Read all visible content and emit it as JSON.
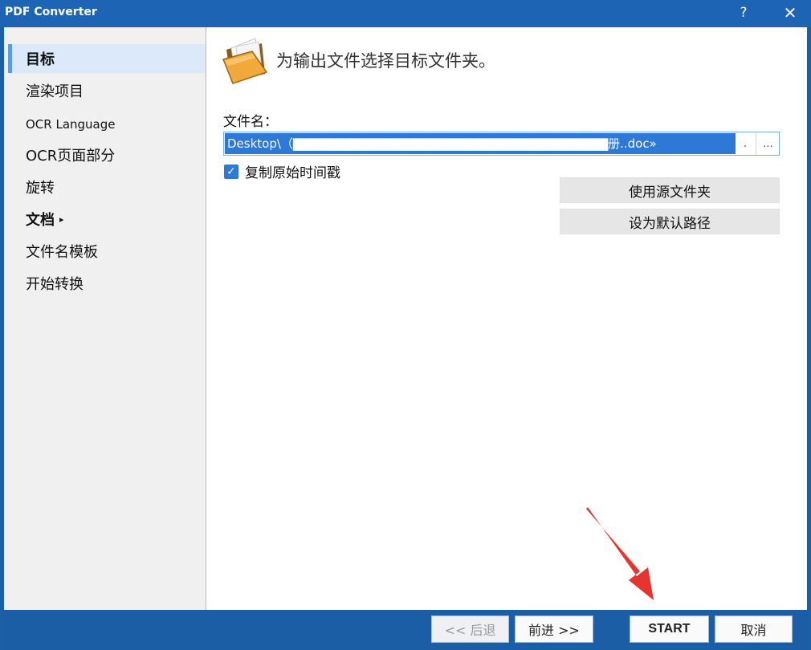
{
  "window": {
    "title": "PDF Converter",
    "help_label": "?",
    "close_label": "✕"
  },
  "sidebar": {
    "items": [
      {
        "label": "目标"
      },
      {
        "label": "渲染项目"
      },
      {
        "label": "OCR Language"
      },
      {
        "label": "OCR页面部分"
      },
      {
        "label": "旋转"
      },
      {
        "label": "文档"
      },
      {
        "label": "文件名模板"
      },
      {
        "label": "开始转换"
      }
    ],
    "caret": "▸"
  },
  "main": {
    "heading": "为输出文件选择目标文件夹。",
    "filename_label": "文件名：",
    "path_value": "Desktop\\（▇▇▇▇▇▇▇▇▇▇▇▇▇▇▇▇▇▇▇▇▇▇▇▇▇▇▇▇▇▇▇▇▇▇册..doc»",
    "dot_button": ".",
    "browse_button": "...",
    "copy_timestamp_label": "复制原始时间戳",
    "use_source_folder_label": "使用源文件夹",
    "set_default_path_label": "设为默认路径"
  },
  "footer": {
    "prev_label": "<< 后退",
    "next_label": "前进 >>",
    "start_label": "START",
    "cancel_label": "取消"
  },
  "colors": {
    "titlebar": "#1e64b4",
    "selection": "#2e78d6",
    "annotation_arrow": "#e8342e"
  }
}
